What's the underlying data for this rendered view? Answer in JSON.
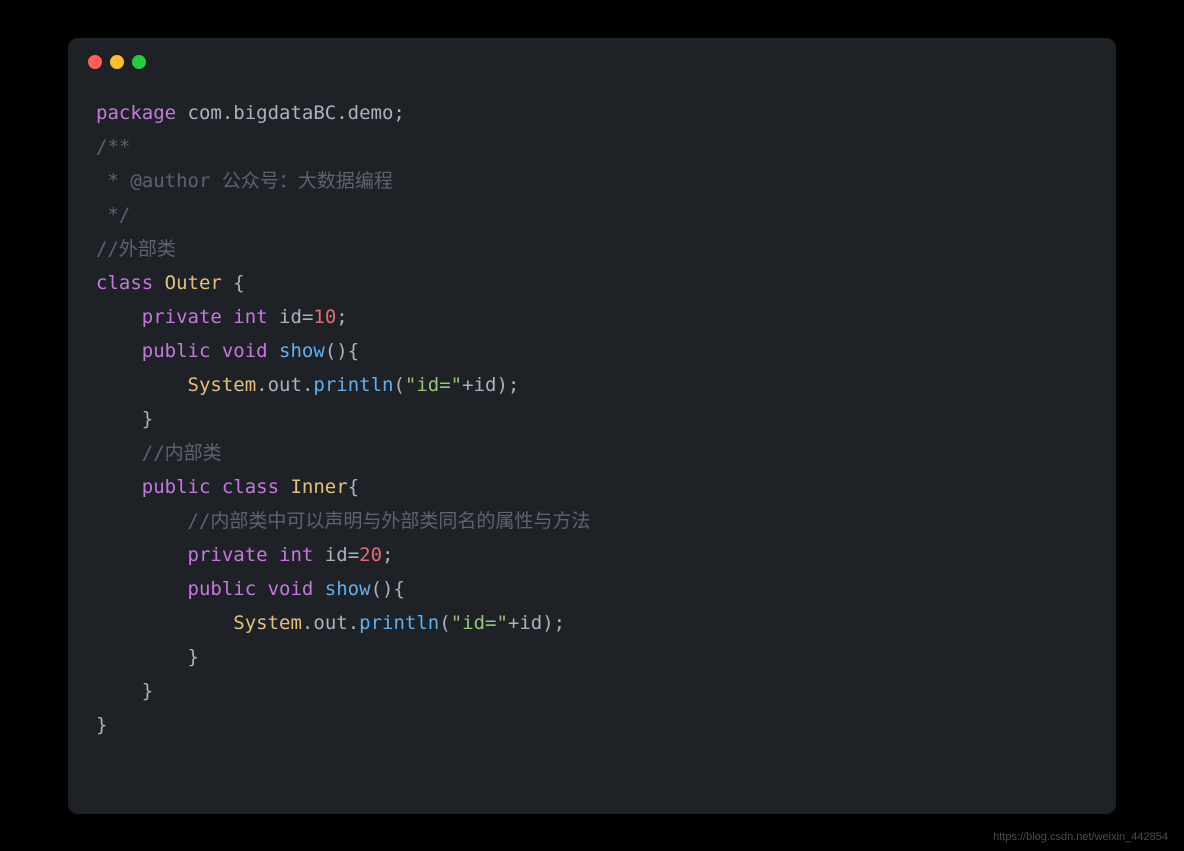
{
  "code": {
    "l1_package": "package",
    "l1_path": " com.bigdataBC.demo",
    "l1_semi": ";",
    "l2_comment": "/**",
    "l3_comment": " * @author 公众号：大数据编程",
    "l4_comment": " */",
    "l5_comment": "//外部类",
    "l6_class": "class",
    "l6_name": " Outer ",
    "l6_brace": "{",
    "l7_indent": "    ",
    "l7_private": "private",
    "l7_int": " int",
    "l7_id": " id",
    "l7_eq": "=",
    "l7_num": "10",
    "l7_semi": ";",
    "l8_indent": "    ",
    "l8_public": "public",
    "l8_void": " void",
    "l8_method": " show",
    "l8_parens": "()",
    "l8_brace": "{",
    "l9_indent": "        ",
    "l9_system": "System",
    "l9_dot1": ".",
    "l9_out": "out",
    "l9_dot2": ".",
    "l9_println": "println",
    "l9_open": "(",
    "l9_str": "\"id=\"",
    "l9_plus": "+",
    "l9_id": "id",
    "l9_close": ");",
    "l10_indent": "    ",
    "l10_brace": "}",
    "l11_indent": "    ",
    "l11_comment": "//内部类",
    "l12_indent": "    ",
    "l12_public": "public",
    "l12_class": " class",
    "l12_name": " Inner",
    "l12_brace": "{",
    "l13_indent": "        ",
    "l13_comment": "//内部类中可以声明与外部类同名的属性与方法",
    "l14_indent": "        ",
    "l14_private": "private",
    "l14_int": " int",
    "l14_id": " id",
    "l14_eq": "=",
    "l14_num": "20",
    "l14_semi": ";",
    "l15_indent": "        ",
    "l15_public": "public",
    "l15_void": " void",
    "l15_method": " show",
    "l15_parens": "()",
    "l15_brace": "{",
    "l16_indent": "            ",
    "l16_system": "System",
    "l16_dot1": ".",
    "l16_out": "out",
    "l16_dot2": ".",
    "l16_println": "println",
    "l16_open": "(",
    "l16_str": "\"id=\"",
    "l16_plus": "+",
    "l16_id": "id",
    "l16_close": ");",
    "l17_indent": "        ",
    "l17_brace": "}",
    "l18_indent": "    ",
    "l18_brace": "}",
    "l19_brace": "}"
  },
  "watermark": "https://blog.csdn.net/weixin_442854"
}
